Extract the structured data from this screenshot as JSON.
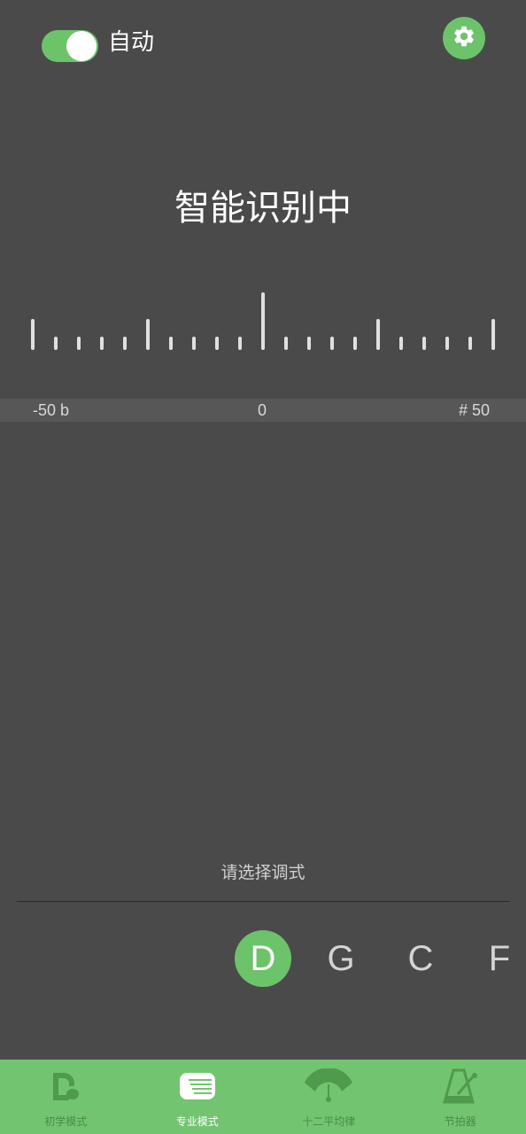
{
  "header": {
    "auto_toggle_on": true,
    "auto_label": "自动",
    "settings_icon": "gear-icon"
  },
  "tuner": {
    "status": "智能识别中",
    "scale_left": "-50 b",
    "scale_center": "0",
    "scale_right": "# 50"
  },
  "mode_select": {
    "prompt": "请选择调式",
    "keys": [
      {
        "label": "D",
        "active": true
      },
      {
        "label": "G",
        "active": false
      },
      {
        "label": "C",
        "active": false
      },
      {
        "label": "F",
        "active": false
      }
    ]
  },
  "bottom_nav": {
    "items": [
      {
        "label": "初学模式",
        "icon": "beginner-icon",
        "active": false
      },
      {
        "label": "专业模式",
        "icon": "professional-icon",
        "active": true
      },
      {
        "label": "十二平均律",
        "icon": "equal-temperament-icon",
        "active": false
      },
      {
        "label": "节拍器",
        "icon": "metronome-icon",
        "active": false
      }
    ]
  },
  "colors": {
    "background": "#4a4a4a",
    "accent": "#6cc36a",
    "nav_background": "#72c470"
  }
}
